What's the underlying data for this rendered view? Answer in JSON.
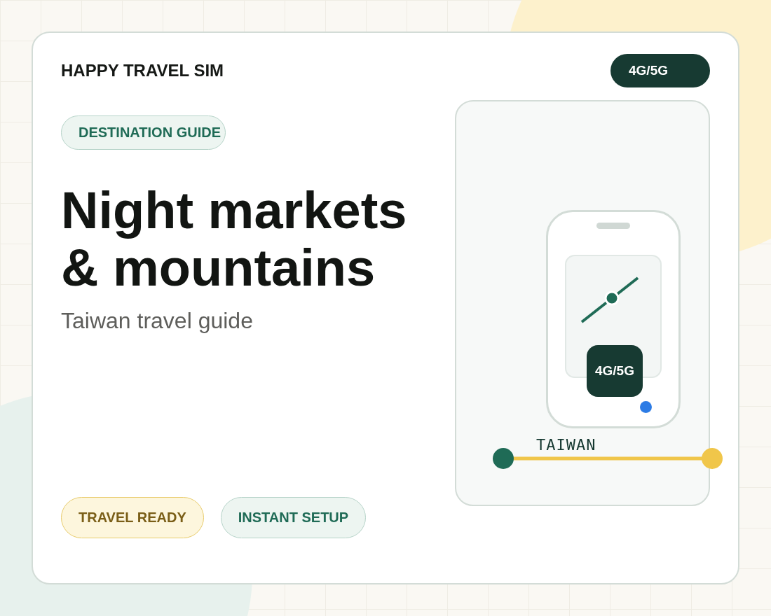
{
  "brand": "HAPPY TRAVEL SIM",
  "network_badge": "4G/5G",
  "eyebrow": "DESTINATION GUIDE",
  "headline": [
    "Night markets",
    "& mountains"
  ],
  "subtitle": "Taiwan travel guide",
  "tags": [
    {
      "label": "TRAVEL READY",
      "kind": "gold"
    },
    {
      "label": "INSTANT SETUP",
      "kind": "green"
    }
  ],
  "illustration": {
    "screen_badge": "4G/5G",
    "route_label": "TAIWAN"
  }
}
